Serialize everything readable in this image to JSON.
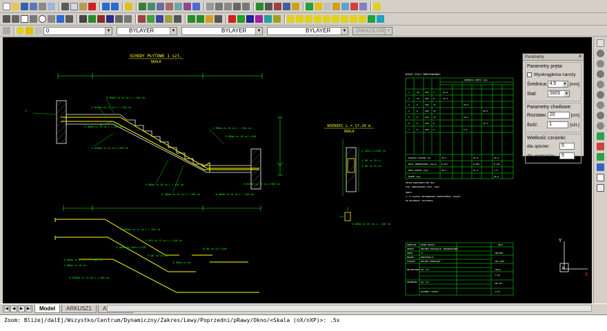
{
  "toolbar_row3": {
    "layer_value": "0",
    "color_value": "BYLAYER",
    "linetype_value": "BYLAYER",
    "lineweight_value": "BYLAYER",
    "plotstyle_value": "JAKKOLOR"
  },
  "drawing": {
    "title1": "SCHODY PŁYTOWE 1 szt.",
    "title1_sub": "SKALA",
    "title2": "WIENIEC L = 17.20 m",
    "title2_sub": "SKALA",
    "table_title": "WYKAZ STALI ZBROJENIOWEJ",
    "table_header": "SREDNICA PRETA [mm]",
    "notes_title": "UWAGI",
    "note1": "1. W CALOSCI BETONOWANIA PRZESTRZEGAC ZASADY",
    "note2": "   PN EN/DEPOCT ZALECENIA",
    "note_line1": "BETON KONSTRUKCYJNY B20",
    "note_line2": "STAL ZBROJENIOWA St0S, 34GS",
    "ucs_y": "Y",
    "ucs_x": "X",
    "ucs_w": "W"
  },
  "panel": {
    "title": "Parametry",
    "group1_label": "Parametry pręta:",
    "checkbox_label": "Wyokrąglenia naroży",
    "diameter_label": "Średnica:",
    "diameter_value": "4.5",
    "diameter_unit": "[mm]",
    "steel_label": "Stal:",
    "steel_value": "St0S",
    "group2_label": "Parametry chwilowe:",
    "spacing_label": "Rozstaw:",
    "spacing_value": "20",
    "spacing_unit": "[cm]",
    "count_label": "Ilość:",
    "count_value": "1",
    "count_unit": "[szt.]",
    "group3_label": "Wielkość czcionki:",
    "desc_label": "dla opisów:",
    "desc_value": "5",
    "dim_label": "dla wymiarów:",
    "dim_value": "5"
  },
  "sheet_tabs": [
    "Model",
    "ARKUSZ1",
    "ARKUSZ2"
  ],
  "active_tab": "Model",
  "command_line": "Zoom:  Bliżej/dalEj/Wszystko/Centrum/Dynamiczny/Zakres/Lewy/Poprzedni/pRawy/Okno/<Skala (nX/nXP)>: .5x",
  "colors": {
    "drawing_line": "#ffffff",
    "rebar": "#ffff00",
    "dimension": "#00ff00",
    "text_yellow": "#ffff00",
    "table_line": "#00ff00"
  }
}
